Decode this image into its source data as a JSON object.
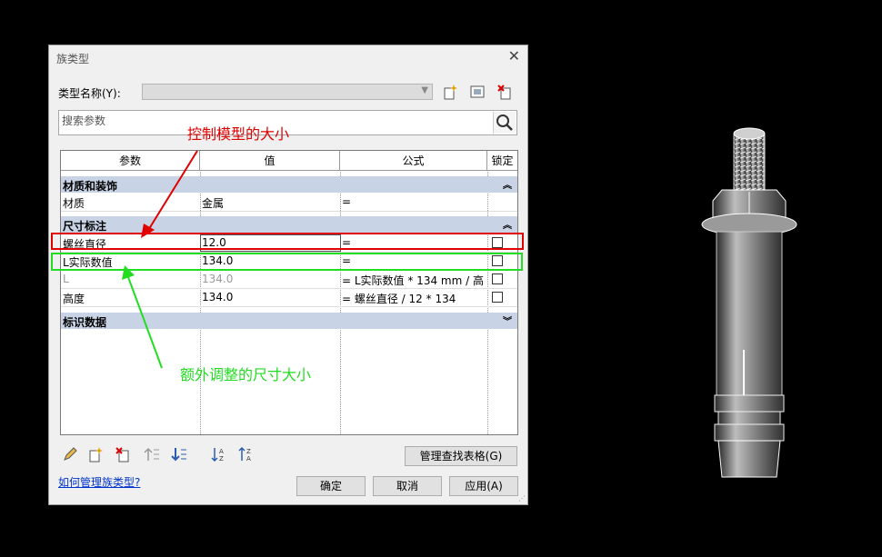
{
  "dialog": {
    "title": "族类型",
    "type_name_label": "类型名称(Y):",
    "type_name_value": "",
    "search_placeholder": "搜索参数",
    "columns": [
      "参数",
      "值",
      "公式",
      "锁定"
    ],
    "groups": [
      {
        "label": "材质和装饰",
        "rows": [
          {
            "param": "材质",
            "value": "金属",
            "formula": "=",
            "locked": false,
            "has_lock": false,
            "greyed": false
          }
        ]
      },
      {
        "label": "尺寸标注",
        "rows": [
          {
            "param": "螺丝直径",
            "value": "12.0",
            "formula": "=",
            "locked": false,
            "has_lock": true,
            "greyed": false
          },
          {
            "param": "L实际数值",
            "value": "134.0",
            "formula": "=",
            "locked": false,
            "has_lock": true,
            "greyed": false
          },
          {
            "param": "L",
            "value": "134.0",
            "formula": "= L实际数值 * 134 mm / 高",
            "locked": false,
            "has_lock": true,
            "greyed": true
          },
          {
            "param": "高度",
            "value": "134.0",
            "formula": "= 螺丝直径 / 12 * 134",
            "locked": false,
            "has_lock": true,
            "greyed": false
          }
        ]
      },
      {
        "label": "标识数据",
        "rows": []
      }
    ],
    "manage_lookup_label": "管理查找表格(G)",
    "help_link": "如何管理族类型?",
    "ok_label": "确定",
    "cancel_label": "取消",
    "apply_label": "应用(A)"
  },
  "annotations": {
    "red_text": "控制模型的大小",
    "green_text": "额外调整的尺寸大小",
    "red_color": "#e00000",
    "green_color": "#22dd22"
  }
}
